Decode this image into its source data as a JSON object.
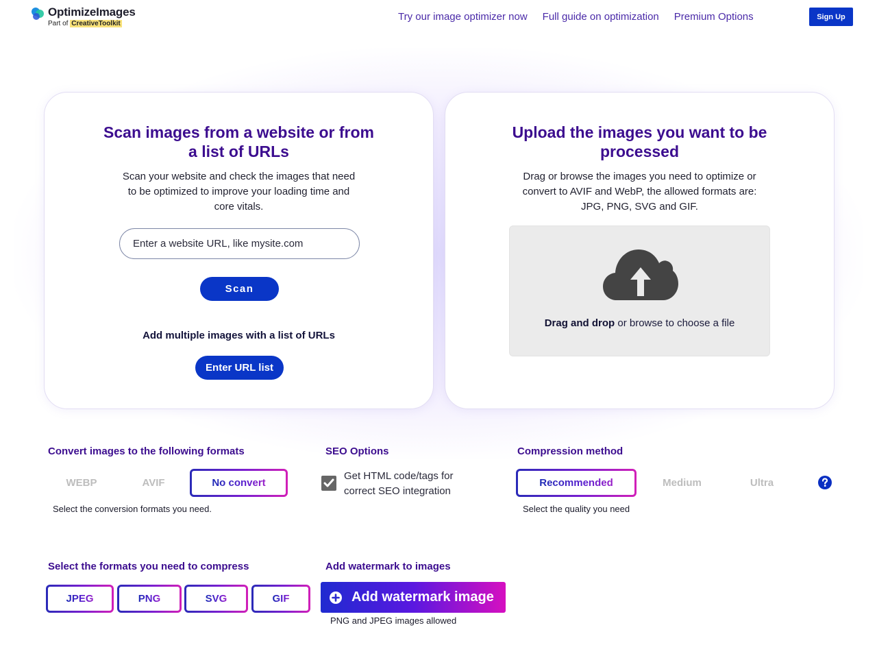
{
  "header": {
    "brand": "OptimizeImages",
    "sub_prefix": "Part of ",
    "sub_highlight": "CreativeToolkit",
    "nav": [
      {
        "label": "Try our image optimizer now"
      },
      {
        "label": "Full guide on optimization"
      },
      {
        "label": "Premium Options"
      }
    ],
    "signup_label": "Sign Up"
  },
  "scan_card": {
    "title": "Scan images from a website or from a list of URLs",
    "description": "Scan your website and check the images that need to be optimized to improve your loading time and core vitals.",
    "url_input": {
      "placeholder": "Enter a website URL, like mysite.com",
      "value": ""
    },
    "scan_label": "Scan",
    "multi_label": "Add multiple images with a list of URLs",
    "url_list_label": "Enter URL list"
  },
  "upload_card": {
    "title": "Upload the images you want to be processed",
    "description": "Drag or browse the images you need to optimize or convert to AVIF and WebP, the allowed formats are: JPG, PNG, SVG and GIF.",
    "drop_bold": "Drag and drop",
    "drop_rest": " or browse to choose a file",
    "icon": "cloud-upload-icon"
  },
  "convert": {
    "title": "Convert images to the following formats",
    "options": [
      {
        "label": "WEBP",
        "selected": false
      },
      {
        "label": "AVIF",
        "selected": false
      },
      {
        "label": "No convert",
        "selected": true
      }
    ],
    "help": "Select the conversion formats you need."
  },
  "seo": {
    "title": "SEO Options",
    "checkbox_label_line1": "Get HTML code/tags for",
    "checkbox_label_line2": "correct SEO integration",
    "checked": true
  },
  "compression": {
    "title": "Compression method",
    "options": [
      {
        "label": "Recommended",
        "selected": true
      },
      {
        "label": "Medium",
        "selected": false
      },
      {
        "label": "Ultra",
        "selected": false
      }
    ],
    "help": "Select the quality you need",
    "help_icon": "question-circle-icon"
  },
  "compress_formats": {
    "title": "Select the formats you need to compress",
    "options": [
      {
        "label": "JPEG",
        "selected": true
      },
      {
        "label": "PNG",
        "selected": true
      },
      {
        "label": "SVG",
        "selected": true
      },
      {
        "label": "GIF",
        "selected": true
      }
    ]
  },
  "watermark": {
    "title": "Add watermark to images",
    "button_label": "Add watermark image",
    "help": "PNG and JPEG images allowed"
  },
  "colors": {
    "primary": "#0a36c7",
    "heading": "#3c0d8f",
    "nav_link": "#4a2aa8",
    "highlight": "#f9e27a",
    "gradient_start": "#1f2ad0",
    "gradient_end": "#d60fc0"
  }
}
